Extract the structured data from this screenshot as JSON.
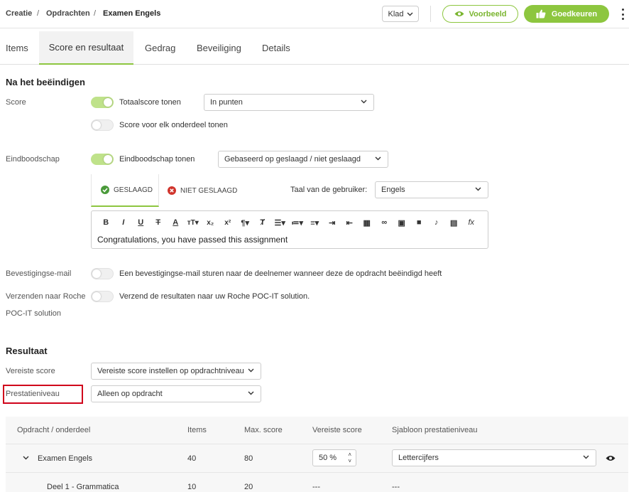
{
  "breadcrumb": {
    "part1": "Creatie",
    "part2": "Opdrachten",
    "current": "Examen Engels",
    "separator": "/"
  },
  "header": {
    "status_label": "Klad",
    "preview_label": "Voorbeeld",
    "approve_label": "Goedkeuren"
  },
  "tabs": [
    {
      "label": "Items"
    },
    {
      "label": "Score en resultaat"
    },
    {
      "label": "Gedrag"
    },
    {
      "label": "Beveiliging"
    },
    {
      "label": "Details"
    }
  ],
  "na_het_beeindigen": {
    "heading": "Na het beëindigen",
    "score_label": "Score",
    "totaalscore_label": "Totaalscore tonen",
    "totaalscore_on": true,
    "score_type_value": "In punten",
    "onderdeel_label": "Score voor elk onderdeel tonen",
    "onderdeel_on": false,
    "eindboodschap_label": "Eindboodschap",
    "eindboodschap_toggle_label": "Eindboodschap tonen",
    "eindboodschap_on": true,
    "eindboodschap_select_value": "Gebaseerd op geslaagd / niet geslaagd",
    "tab_geslaagd": "GESLAAGD",
    "tab_niet_geslaagd": "NIET GESLAAGD",
    "taal_label": "Taal van de gebruiker:",
    "taal_value": "Engels",
    "editor_text": "Congratulations, you have passed this assignment",
    "bevestiging_label": "Bevestigingse-mail",
    "bevestiging_text": "Een bevestigingse-mail sturen naar de deelnemer wanneer deze de opdracht beëindigd heeft",
    "bevestiging_on": false,
    "roche_label_line1": "Verzenden naar Roche",
    "roche_label_line2": "POC-IT solution",
    "roche_text": "Verzend de resultaten naar uw Roche POC-IT solution.",
    "roche_on": false
  },
  "resultaat": {
    "heading": "Resultaat",
    "vereiste_label": "Vereiste score",
    "vereiste_value": "Vereiste score instellen op opdrachtniveau",
    "prestatie_label": "Prestatieniveau",
    "prestatie_value": "Alleen op opdracht"
  },
  "table": {
    "headers": [
      "Opdracht / onderdeel",
      "Items",
      "Max. score",
      "Vereiste score",
      "Sjabloon prestatieniveau"
    ],
    "rows": [
      {
        "name": "Examen Engels",
        "items": "40",
        "max": "80",
        "vereiste": "50 %",
        "sjabloon": "Lettercijfers"
      },
      {
        "name": "Deel 1 - Grammatica",
        "items": "10",
        "max": "20",
        "vereiste": "---",
        "sjabloon": "---"
      }
    ]
  },
  "colors": {
    "accent": "#8dc63f",
    "highlight": "#d0021b",
    "success": "#4a9a3a",
    "error": "#d0342c"
  }
}
